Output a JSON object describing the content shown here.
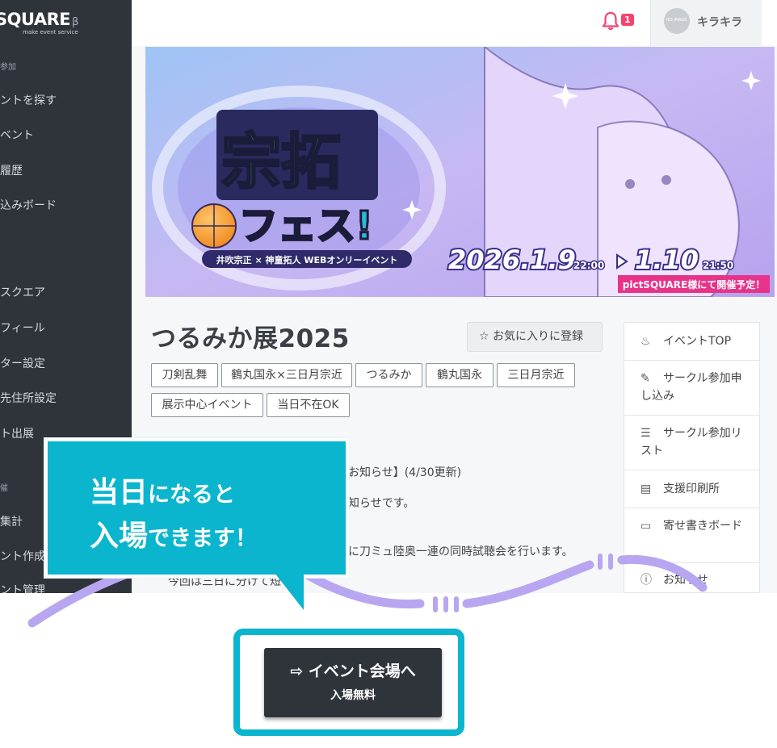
{
  "sidebar": {
    "logo": "SQUARE",
    "logo_beta": "β",
    "logo_sub": "make event service",
    "section_participate": "参加",
    "items": [
      "ントを探す",
      "ベント",
      "履歴",
      "込みボード",
      "スクエア",
      "フィール",
      "ター設定",
      "先住所設定",
      "ト出展"
    ],
    "section_host": "催",
    "host_items": [
      "集計",
      "ント作成",
      "ント管理"
    ]
  },
  "header": {
    "notification_count": "1",
    "avatar_text": "NO IMAGE",
    "user_name": "キラキラ"
  },
  "banner": {
    "title_line1": "宗拓",
    "title_line2": "フェス!",
    "subtitle": "井吹宗正 × 神童拓人  WEBオンリーイベント",
    "date_start": "2026.1.9",
    "time_start": "22:00",
    "date_end": "1.10",
    "time_end": "21:50",
    "host_note": "pictSQUARE様にて開催予定！"
  },
  "event": {
    "title": "つるみか展2025",
    "favorite_label": "お気に入りに登録",
    "tags": [
      "刀剣乱舞",
      "鶴丸国永×三日月宗近",
      "つるみか",
      "鶴丸国永",
      "三日月宗近",
      "展示中心イベント",
      "当日不在OK"
    ],
    "news_lines": [
      "お知らせ】(4/30更新)",
      "知らせです。",
      "に刀ミュ陸奥一連の同時試聴会を行います。",
      "今回は三日に分けて短"
    ]
  },
  "right_nav": [
    {
      "icon": "flame-icon",
      "label": "イベントTOP"
    },
    {
      "icon": "pen-icon",
      "label": "サークル参加申し込み"
    },
    {
      "icon": "list-icon",
      "label": "サークル参加リスト"
    },
    {
      "icon": "building-icon",
      "label": "支援印刷所"
    },
    {
      "icon": "board-icon",
      "label": "寄せ書きボード"
    },
    {
      "icon": "info-icon",
      "label": "お知らせ"
    }
  ],
  "callout": {
    "line1_big": "当日",
    "line1_small": "になると",
    "line2_big": "入場",
    "line2_small": "できます！"
  },
  "enter_button": {
    "label": "イベント会場へ",
    "sub": "入場無料"
  },
  "colors": {
    "sidebar_bg": "#2f343b",
    "accent_cyan": "#0bb5ce",
    "badge_pink": "#f5436e",
    "wave_lavender": "#b9a6f0"
  }
}
